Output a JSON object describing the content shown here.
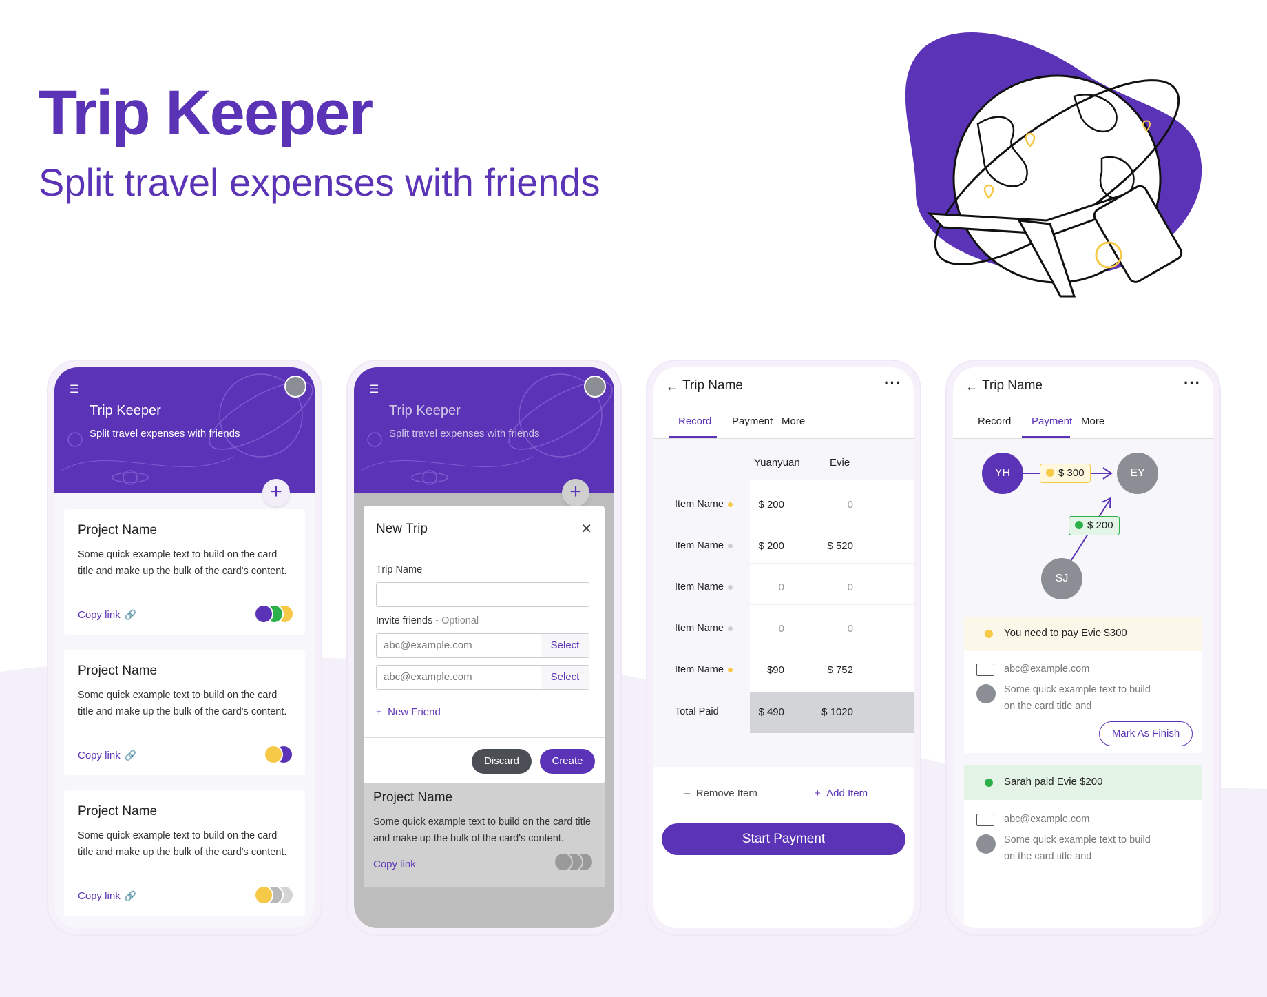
{
  "hero": {
    "title": "Trip Keeper",
    "subtitle": "Split travel expenses with friends"
  },
  "colors": {
    "brand": "#5b33b6",
    "yellow": "#f7c948",
    "green": "#2bb04a",
    "gray": "#8b8e94"
  },
  "home": {
    "app_title": "Trip Keeper",
    "app_subtitle": "Split travel expenses with friends",
    "icons": [
      "menu-icon",
      "avatar",
      "plus-icon",
      "link-icon"
    ],
    "cards": [
      {
        "title": "Project Name",
        "text": "Some quick example text to build on the card title and make up the bulk of the card's content.",
        "link": "Copy link",
        "members": [
          "#5b33b6",
          "#2bb04a",
          "#f7c948"
        ]
      },
      {
        "title": "Project Name",
        "text": "Some quick example text to build on the card title and make up the bulk of the card's content.",
        "link": "Copy link",
        "members": [
          "#f7c948",
          "#5b33b6"
        ]
      },
      {
        "title": "Project Name",
        "text": "Some quick example text to build on the card title and make up the bulk of the card's content.",
        "link": "Copy link",
        "members": [
          "#f7c948",
          "#b8b8b8",
          "#d4d4d4"
        ]
      }
    ]
  },
  "modal": {
    "app_title": "Trip Keeper",
    "app_subtitle": "Split travel expenses with friends",
    "title": "New Trip",
    "trip_name_label": "Trip Name",
    "trip_name_value": "",
    "invite_label": "Invite friends",
    "invite_optional": " - Optional",
    "invite_placeholder_1": "abc@example.com",
    "invite_placeholder_2": "abc@example.com",
    "select_label": "Select",
    "new_friend": "New Friend",
    "discard": "Discard",
    "create": "Create",
    "bg_card": {
      "title": "Project Name",
      "text": "Some quick example text to build on the card title and make up the bulk of the card's content.",
      "link": "Copy link"
    }
  },
  "record": {
    "trip_name": "Trip Name",
    "tabs": [
      "Record",
      "Payment",
      "More"
    ],
    "active_tab": "Record",
    "columns": [
      "Yuanyuan",
      "Evie"
    ],
    "rows": [
      {
        "label": "Item Name",
        "status": "#f7c948",
        "values": [
          "$ 200",
          "0"
        ]
      },
      {
        "label": "Item Name",
        "status": "#cfcfcf",
        "values": [
          "$ 200",
          "$ 520"
        ]
      },
      {
        "label": "Item Name",
        "status": "#cfcfcf",
        "values": [
          "0",
          "0"
        ]
      },
      {
        "label": "Item Name",
        "status": "#cfcfcf",
        "values": [
          "0",
          "0"
        ]
      },
      {
        "label": "Item Name",
        "status": "#f7c948",
        "values": [
          "$90",
          "$ 752"
        ]
      }
    ],
    "total_label": "Total Paid",
    "totals": [
      "$ 490",
      "$ 1020"
    ],
    "remove_item": "Remove Item",
    "add_item": "Add Item",
    "start_payment": "Start Payment"
  },
  "payment": {
    "trip_name": "Trip Name",
    "tabs": [
      "Record",
      "Payment",
      "More"
    ],
    "active_tab": "Payment",
    "nodes": {
      "yh": "YH",
      "ey": "EY",
      "sj": "SJ"
    },
    "flow_yh_ey": "$ 300",
    "flow_sj_ey": "$ 200",
    "notice_1": "You need to pay Evie $300",
    "notice_2": "Sarah paid Evie $200",
    "email": "abc@example.com",
    "note_line1": "Some quick example text to build",
    "note_line2": "on the card title and",
    "mark_finish": "Mark As Finish"
  }
}
